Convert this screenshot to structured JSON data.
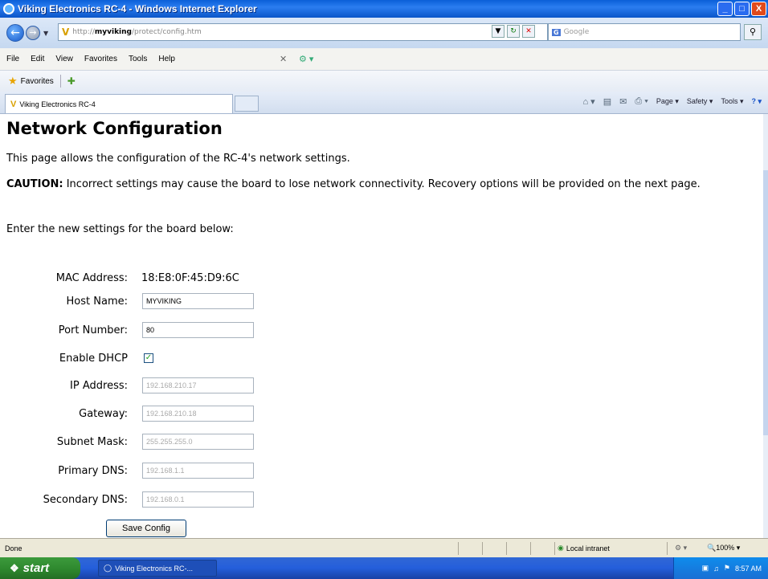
{
  "window": {
    "title": "Viking Electronics RC-4 - Windows Internet Explorer",
    "buttons": {
      "minimize": "_",
      "maximize": "□",
      "close": "X"
    }
  },
  "address_bar": {
    "prefix": "http://",
    "host": "myviking",
    "path": "/protect/config.htm",
    "search_placeholder": "Google"
  },
  "menu": [
    "File",
    "Edit",
    "View",
    "Favorites",
    "Tools",
    "Help"
  ],
  "favorites_bar": {
    "label": "Favorites"
  },
  "tab": {
    "label": "Viking Electronics RC-4"
  },
  "command_bar": {
    "page": "Page",
    "safety": "Safety",
    "tools": "Tools"
  },
  "page": {
    "heading": "Network Configuration",
    "intro": "This page allows the configuration of the RC-4's network settings.",
    "caution_label": "CAUTION:",
    "caution_text": " Incorrect settings may cause the board to lose network connectivity. Recovery options will be provided on the next page.",
    "prompt": "Enter the new settings for the board below:",
    "fields": {
      "mac": {
        "label": "MAC Address:",
        "value": "18:E8:0F:45:D9:6C"
      },
      "host": {
        "label": "Host Name:",
        "value": "MYVIKING"
      },
      "port": {
        "label": "Port Number:",
        "value": "80"
      },
      "dhcp": {
        "label": "Enable DHCP",
        "checked": true
      },
      "ip": {
        "label": "IP Address:",
        "value": "192.168.210.17"
      },
      "gateway": {
        "label": "Gateway:",
        "value": "192.168.210.18"
      },
      "subnet": {
        "label": "Subnet Mask:",
        "value": "255.255.255.0"
      },
      "dns1": {
        "label": "Primary DNS:",
        "value": "192.168.1.1"
      },
      "dns2": {
        "label": "Secondary DNS:",
        "value": "192.168.0.1"
      }
    },
    "save_button": "Save Config"
  },
  "status_bar": {
    "status": "Done",
    "zone": "Local intranet",
    "zoom": "100%"
  },
  "taskbar": {
    "start": "start",
    "task_item": "Viking Electronics RC-...",
    "clock": "8:57 AM"
  }
}
